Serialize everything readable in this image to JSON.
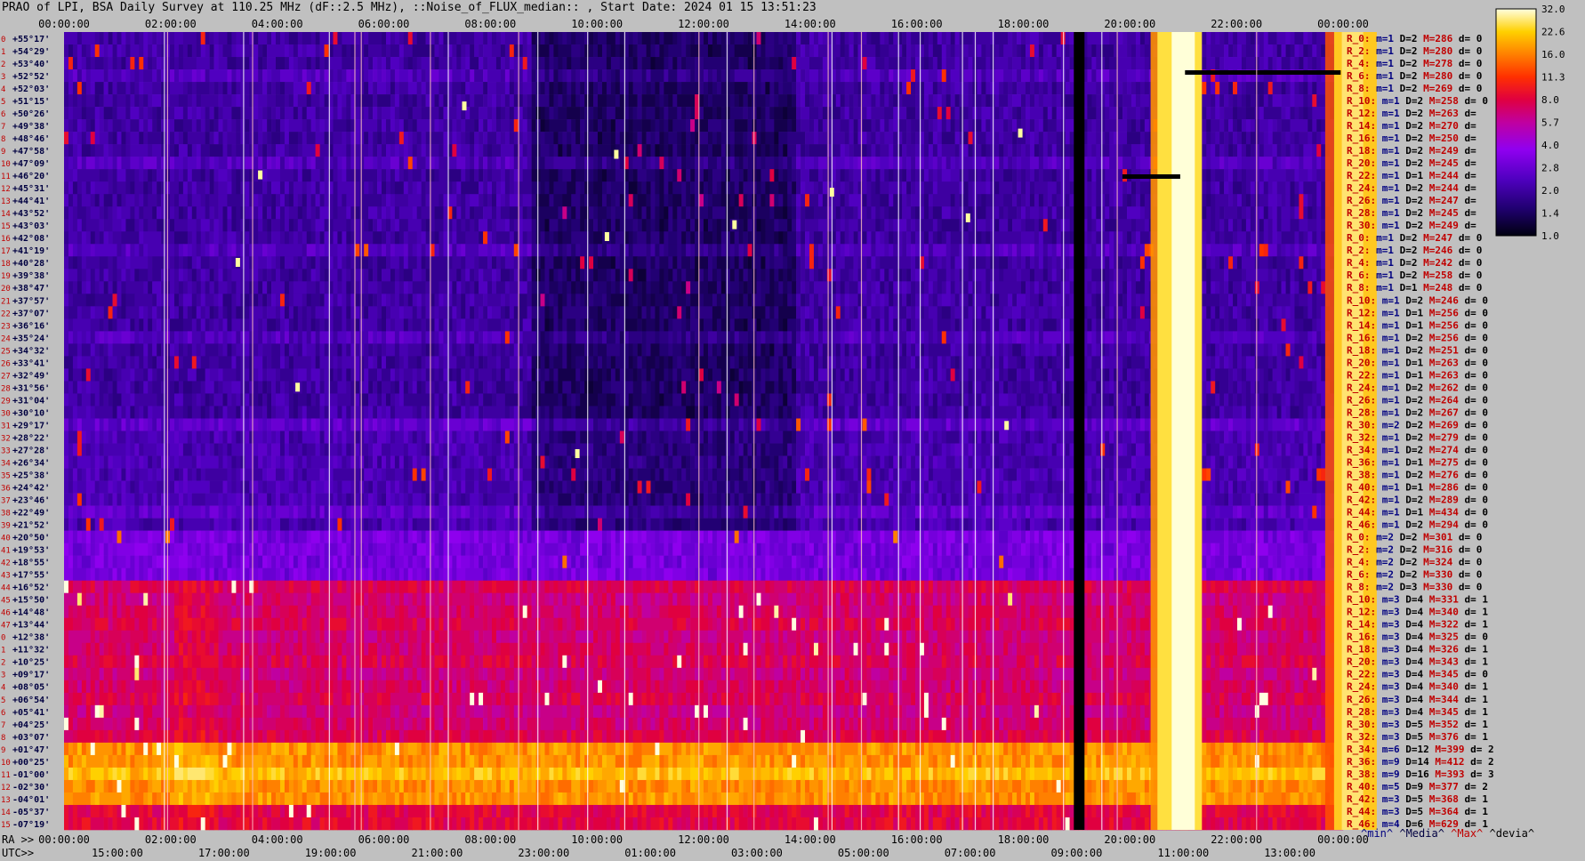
{
  "title": "PRAO of LPI, BSA Daily Survey at 110.25 MHz (dF::2.5 MHz), ::Noise_of_FLUX_median:: , Start Date: 2024 01 15 13:51:23",
  "chart_data": {
    "type": "heatmap",
    "top_axis_labels": [
      "00:00:00",
      "02:00:00",
      "04:00:00",
      "06:00:00",
      "08:00:00",
      "10:00:00",
      "12:00:00",
      "14:00:00",
      "16:00:00",
      "18:00:00",
      "20:00:00",
      "22:00:00",
      "00:00:00"
    ],
    "ra_prefix": "RA >>",
    "ra_labels": [
      "00:00:00",
      "02:00:00",
      "04:00:00",
      "06:00:00",
      "08:00:00",
      "10:00:00",
      "12:00:00",
      "14:00:00",
      "16:00:00",
      "18:00:00",
      "20:00:00",
      "22:00:00",
      "00:00:00"
    ],
    "utc_prefix": "UTC>>",
    "utc_labels": [
      "15:00:00",
      "17:00:00",
      "19:00:00",
      "21:00:00",
      "23:00:00",
      "01:00:00",
      "03:00:00",
      "05:00:00",
      "07:00:00",
      "09:00:00",
      "11:00:00",
      "13:00:00"
    ],
    "declinations": [
      "+55°17'",
      "+54°29'",
      "+53°40'",
      "+52°52'",
      "+52°03'",
      "+51°15'",
      "+50°26'",
      "+49°38'",
      "+48°46'",
      "+47°58'",
      "+47°09'",
      "+46°20'",
      "+45°31'",
      "+44°41'",
      "+43°52'",
      "+43°03'",
      "+42°08'",
      "+41°19'",
      "+40°28'",
      "+39°38'",
      "+38°47'",
      "+37°57'",
      "+37°07'",
      "+36°16'",
      "+35°24'",
      "+34°32'",
      "+33°41'",
      "+32°49'",
      "+31°56'",
      "+31°04'",
      "+30°10'",
      "+29°17'",
      "+28°22'",
      "+27°28'",
      "+26°34'",
      "+25°38'",
      "+24°42'",
      "+23°46'",
      "+22°49'",
      "+21°52'",
      "+20°50'",
      "+19°53'",
      "+18°55'",
      "+17°55'",
      "+16°52'",
      "+15°50'",
      "+14°48'",
      "+13°44'",
      "+12°38'",
      "+11°32'",
      "+10°25'",
      "+09°17'",
      "+08°05'",
      "+06°54'",
      "+05°41'",
      "+04°25'",
      "+03°07'",
      "+01°47'",
      "+00°25'",
      "-01°00'",
      "-02°30'",
      "-04°01'",
      "-05°37'",
      "-07°19'"
    ],
    "stats": [
      {
        "r": "R_0:",
        "m": "m=1",
        "d": "D=2",
        "M": "M=286",
        "dv": "d= 0"
      },
      {
        "r": "R_2:",
        "m": "m=1",
        "d": "D=2",
        "M": "M=280",
        "dv": "d= 0"
      },
      {
        "r": "R_4:",
        "m": "m=1",
        "d": "D=2",
        "M": "M=278",
        "dv": "d= 0"
      },
      {
        "r": "R_6:",
        "m": "m=1",
        "d": "D=2",
        "M": "M=280",
        "dv": "d= 0"
      },
      {
        "r": "R_8:",
        "m": "m=1",
        "d": "D=2",
        "M": "M=269",
        "dv": "d= 0"
      },
      {
        "r": "R_10:",
        "m": "m=1",
        "d": "D=2",
        "M": "M=258",
        "dv": "d= 0"
      },
      {
        "r": "R_12:",
        "m": "m=1",
        "d": "D=2",
        "M": "M=263",
        "dv": "d="
      },
      {
        "r": "R_14:",
        "m": "m=1",
        "d": "D=2",
        "M": "M=270",
        "dv": "d="
      },
      {
        "r": "R_16:",
        "m": "m=1",
        "d": "D=2",
        "M": "M=250",
        "dv": "d="
      },
      {
        "r": "R_18:",
        "m": "m=1",
        "d": "D=2",
        "M": "M=249",
        "dv": "d="
      },
      {
        "r": "R_20:",
        "m": "m=1",
        "d": "D=2",
        "M": "M=245",
        "dv": "d="
      },
      {
        "r": "R_22:",
        "m": "m=1",
        "d": "D=1",
        "M": "M=244",
        "dv": "d="
      },
      {
        "r": "R_24:",
        "m": "m=1",
        "d": "D=2",
        "M": "M=244",
        "dv": "d="
      },
      {
        "r": "R_26:",
        "m": "m=1",
        "d": "D=2",
        "M": "M=247",
        "dv": "d="
      },
      {
        "r": "R_28:",
        "m": "m=1",
        "d": "D=2",
        "M": "M=245",
        "dv": "d="
      },
      {
        "r": "R_30:",
        "m": "m=1",
        "d": "D=2",
        "M": "M=249",
        "dv": "d="
      },
      {
        "r": "R_0:",
        "m": "m=1",
        "d": "D=2",
        "M": "M=247",
        "dv": "d= 0"
      },
      {
        "r": "R_2:",
        "m": "m=1",
        "d": "D=2",
        "M": "M=246",
        "dv": "d= 0"
      },
      {
        "r": "R_4:",
        "m": "m=1",
        "d": "D=2",
        "M": "M=242",
        "dv": "d= 0"
      },
      {
        "r": "R_6:",
        "m": "m=1",
        "d": "D=2",
        "M": "M=258",
        "dv": "d= 0"
      },
      {
        "r": "R_8:",
        "m": "m=1",
        "d": "D=1",
        "M": "M=248",
        "dv": "d= 0"
      },
      {
        "r": "R_10:",
        "m": "m=1",
        "d": "D=2",
        "M": "M=246",
        "dv": "d= 0"
      },
      {
        "r": "R_12:",
        "m": "m=1",
        "d": "D=1",
        "M": "M=256",
        "dv": "d= 0"
      },
      {
        "r": "R_14:",
        "m": "m=1",
        "d": "D=1",
        "M": "M=256",
        "dv": "d= 0"
      },
      {
        "r": "R_16:",
        "m": "m=1",
        "d": "D=2",
        "M": "M=256",
        "dv": "d= 0"
      },
      {
        "r": "R_18:",
        "m": "m=1",
        "d": "D=2",
        "M": "M=251",
        "dv": "d= 0"
      },
      {
        "r": "R_20:",
        "m": "m=1",
        "d": "D=1",
        "M": "M=263",
        "dv": "d= 0"
      },
      {
        "r": "R_22:",
        "m": "m=1",
        "d": "D=1",
        "M": "M=263",
        "dv": "d= 0"
      },
      {
        "r": "R_24:",
        "m": "m=1",
        "d": "D=2",
        "M": "M=262",
        "dv": "d= 0"
      },
      {
        "r": "R_26:",
        "m": "m=1",
        "d": "D=2",
        "M": "M=264",
        "dv": "d= 0"
      },
      {
        "r": "R_28:",
        "m": "m=1",
        "d": "D=2",
        "M": "M=267",
        "dv": "d= 0"
      },
      {
        "r": "R_30:",
        "m": "m=2",
        "d": "D=2",
        "M": "M=269",
        "dv": "d= 0"
      },
      {
        "r": "R_32:",
        "m": "m=1",
        "d": "D=2",
        "M": "M=279",
        "dv": "d= 0"
      },
      {
        "r": "R_34:",
        "m": "m=1",
        "d": "D=2",
        "M": "M=274",
        "dv": "d= 0"
      },
      {
        "r": "R_36:",
        "m": "m=1",
        "d": "D=1",
        "M": "M=275",
        "dv": "d= 0"
      },
      {
        "r": "R_38:",
        "m": "m=1",
        "d": "D=2",
        "M": "M=276",
        "dv": "d= 0"
      },
      {
        "r": "R_40:",
        "m": "m=1",
        "d": "D=1",
        "M": "M=286",
        "dv": "d= 0"
      },
      {
        "r": "R_42:",
        "m": "m=1",
        "d": "D=2",
        "M": "M=289",
        "dv": "d= 0"
      },
      {
        "r": "R_44:",
        "m": "m=1",
        "d": "D=1",
        "M": "M=434",
        "dv": "d= 0"
      },
      {
        "r": "R_46:",
        "m": "m=1",
        "d": "D=2",
        "M": "M=294",
        "dv": "d= 0"
      },
      {
        "r": "R_0:",
        "m": "m=2",
        "d": "D=2",
        "M": "M=301",
        "dv": "d= 0"
      },
      {
        "r": "R_2:",
        "m": "m=2",
        "d": "D=2",
        "M": "M=316",
        "dv": "d= 0"
      },
      {
        "r": "R_4:",
        "m": "m=2",
        "d": "D=2",
        "M": "M=324",
        "dv": "d= 0"
      },
      {
        "r": "R_6:",
        "m": "m=2",
        "d": "D=2",
        "M": "M=330",
        "dv": "d= 0"
      },
      {
        "r": "R_8:",
        "m": "m=2",
        "d": "D=3",
        "M": "M=330",
        "dv": "d= 0"
      },
      {
        "r": "R_10:",
        "m": "m=3",
        "d": "D=4",
        "M": "M=331",
        "dv": "d= 1"
      },
      {
        "r": "R_12:",
        "m": "m=3",
        "d": "D=4",
        "M": "M=340",
        "dv": "d= 1"
      },
      {
        "r": "R_14:",
        "m": "m=3",
        "d": "D=4",
        "M": "M=322",
        "dv": "d= 1"
      },
      {
        "r": "R_16:",
        "m": "m=3",
        "d": "D=4",
        "M": "M=325",
        "dv": "d= 0"
      },
      {
        "r": "R_18:",
        "m": "m=3",
        "d": "D=4",
        "M": "M=326",
        "dv": "d= 1"
      },
      {
        "r": "R_20:",
        "m": "m=3",
        "d": "D=4",
        "M": "M=343",
        "dv": "d= 1"
      },
      {
        "r": "R_22:",
        "m": "m=3",
        "d": "D=4",
        "M": "M=345",
        "dv": "d= 0"
      },
      {
        "r": "R_24:",
        "m": "m=3",
        "d": "D=4",
        "M": "M=340",
        "dv": "d= 1"
      },
      {
        "r": "R_26:",
        "m": "m=3",
        "d": "D=4",
        "M": "M=344",
        "dv": "d= 1"
      },
      {
        "r": "R_28:",
        "m": "m=3",
        "d": "D=4",
        "M": "M=345",
        "dv": "d= 1"
      },
      {
        "r": "R_30:",
        "m": "m=3",
        "d": "D=5",
        "M": "M=352",
        "dv": "d= 1"
      },
      {
        "r": "R_32:",
        "m": "m=3",
        "d": "D=5",
        "M": "M=376",
        "dv": "d= 1"
      },
      {
        "r": "R_34:",
        "m": "m=6",
        "d": "D=12",
        "M": "M=399",
        "dv": "d= 2"
      },
      {
        "r": "R_36:",
        "m": "m=9",
        "d": "D=14",
        "M": "M=412",
        "dv": "d= 2"
      },
      {
        "r": "R_38:",
        "m": "m=9",
        "d": "D=16",
        "M": "M=393",
        "dv": "d= 3"
      },
      {
        "r": "R_40:",
        "m": "m=5",
        "d": "D=9",
        "M": "M=377",
        "dv": "d= 2"
      },
      {
        "r": "R_42:",
        "m": "m=3",
        "d": "D=5",
        "M": "M=368",
        "dv": "d= 1"
      },
      {
        "r": "R_44:",
        "m": "m=3",
        "d": "D=5",
        "M": "M=364",
        "dv": "d= 1"
      },
      {
        "r": "R_46:",
        "m": "m=4",
        "d": "D=6",
        "M": "M=629",
        "dv": "d= 1"
      }
    ],
    "colorbar_ticks": [
      "32.0",
      "22.6",
      "16.0",
      "11.3",
      "8.0",
      "5.7",
      "4.0",
      "2.8",
      "2.0",
      "1.4",
      "1.0"
    ],
    "footer_legend": {
      "min": "^min^",
      "median": "^Media^",
      "max": "^Max^",
      "devia": "^devia^"
    }
  },
  "colors": {
    "page_bg": "#c0c0c0",
    "label_red": "#c00000",
    "label_blue": "#000080",
    "label_dark": "#000040"
  }
}
